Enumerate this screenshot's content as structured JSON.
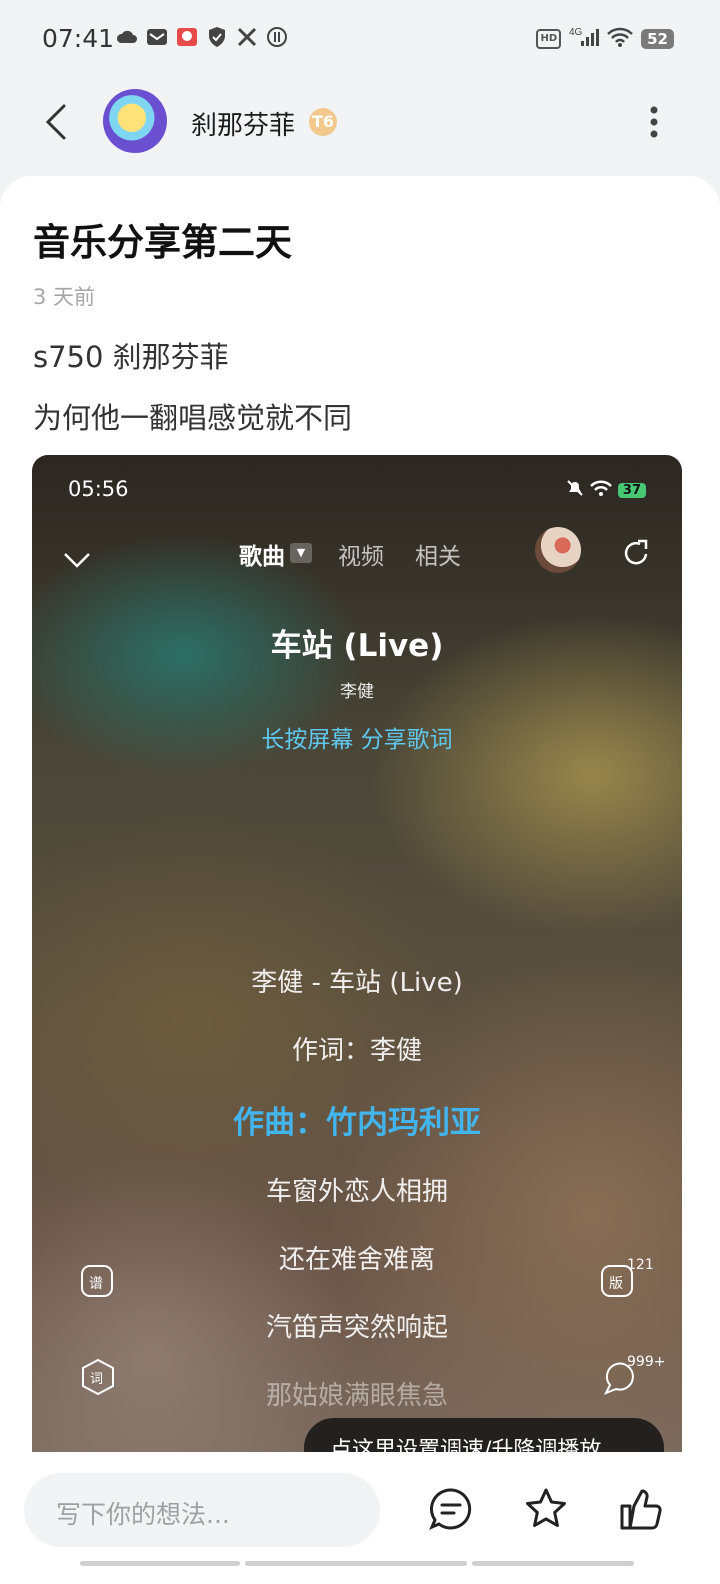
{
  "status_bar": {
    "time": "07:41",
    "network": "4G",
    "battery": "52"
  },
  "header": {
    "username": "刹那芬菲",
    "badge": "T6"
  },
  "post": {
    "title": "音乐分享第二天",
    "time_ago": "3 天前",
    "line1": "s750  刹那芬菲",
    "line2": "为何他一翻唱感觉就不同"
  },
  "embedded": {
    "status_time": "05:56",
    "battery": "37",
    "tabs": [
      "歌曲",
      "视频",
      "相关"
    ],
    "song_title": "车站 (Live)",
    "artist": "李健",
    "share_hint": "长按屏幕 分享歌词",
    "lyrics": [
      "李健 - 车站 (Live)",
      "作词：李健",
      "作曲：竹内玛利亚",
      "车窗外恋人相拥",
      "还在难舍难离",
      "汽笛声突然响起",
      "那姑娘满眼焦急"
    ],
    "side_left_top": "谱",
    "side_left_bottom": "词",
    "side_right_top": "版",
    "side_right_top_count": "121",
    "side_right_bottom_count": "999+",
    "speed_tip": "点这里设置调速/升降调播放"
  },
  "bottom": {
    "comment_placeholder": "写下你的想法..."
  },
  "colors": {
    "accent_blue": "#43b5ee",
    "hint_blue": "#5ec8ef"
  }
}
